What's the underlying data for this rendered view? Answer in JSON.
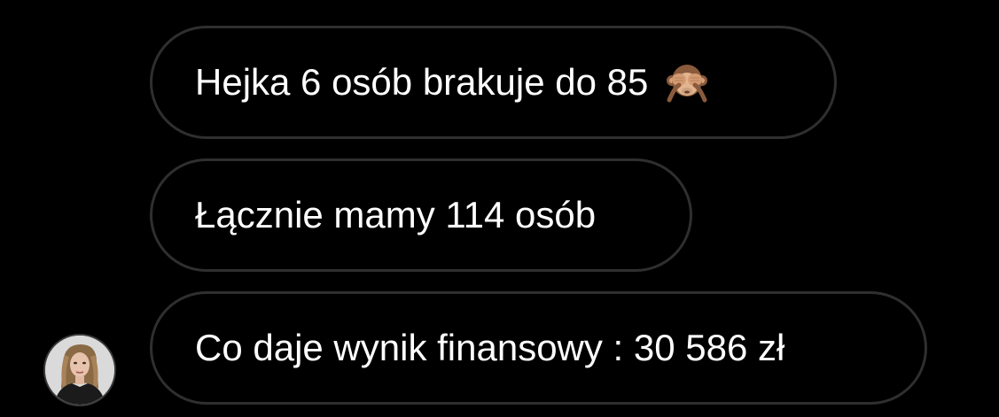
{
  "messages": [
    {
      "text": "Hejka 6 osób brakuje do 85",
      "emoji": "see-no-evil-monkey-icon"
    },
    {
      "text": "Łącznie mamy 114 osób"
    },
    {
      "text": "Co daje wynik finansowy : 30 586 zł"
    }
  ],
  "colors": {
    "background": "#000000",
    "bubble_border": "#2f2f2f",
    "text": "#ffffff"
  }
}
